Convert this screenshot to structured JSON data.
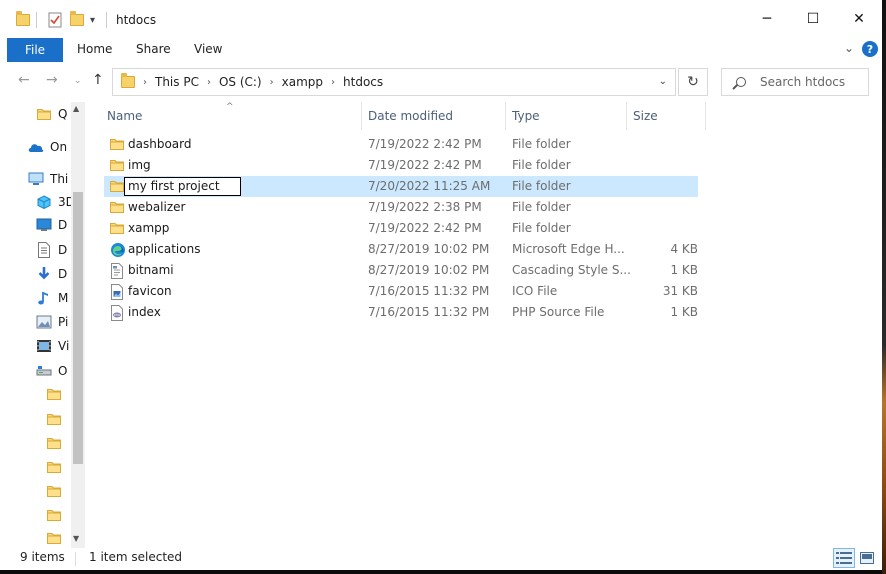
{
  "window": {
    "title": "htdocs",
    "controls": {
      "minimize": "─",
      "maximize": "☐",
      "close": "✕"
    }
  },
  "ribbon": {
    "file": "File",
    "tabs": [
      "Home",
      "Share",
      "View"
    ]
  },
  "address": {
    "crumbs": [
      "This PC",
      "OS (C:)",
      "xampp",
      "htdocs"
    ],
    "search_placeholder": "Search htdocs"
  },
  "nav_pane": {
    "items": [
      {
        "label": "Q",
        "icon": "folder-icon"
      },
      {
        "label": "On",
        "icon": "onedrive-icon"
      },
      {
        "label": "Thi",
        "icon": "pc-icon"
      },
      {
        "label": "3D",
        "icon": "3d-objects-icon"
      },
      {
        "label": "D",
        "icon": "desktop-icon"
      },
      {
        "label": "D",
        "icon": "documents-icon"
      },
      {
        "label": "D",
        "icon": "downloads-icon"
      },
      {
        "label": "M",
        "icon": "music-icon"
      },
      {
        "label": "Pi",
        "icon": "pictures-icon"
      },
      {
        "label": "Vi",
        "icon": "videos-icon"
      },
      {
        "label": "O",
        "icon": "drive-icon"
      },
      {
        "label": "",
        "icon": "folder-icon"
      },
      {
        "label": "",
        "icon": "folder-icon"
      },
      {
        "label": "",
        "icon": "folder-icon"
      },
      {
        "label": "",
        "icon": "folder-icon"
      },
      {
        "label": "",
        "icon": "folder-icon"
      },
      {
        "label": "",
        "icon": "folder-icon"
      },
      {
        "label": "",
        "icon": "folder-icon"
      }
    ]
  },
  "columns": {
    "name": "Name",
    "date": "Date modified",
    "type": "Type",
    "size": "Size"
  },
  "files": [
    {
      "name": "dashboard",
      "date": "7/19/2022 2:42 PM",
      "type": "File folder",
      "size": "",
      "icon": "folder-icon"
    },
    {
      "name": "img",
      "date": "7/19/2022 2:42 PM",
      "type": "File folder",
      "size": "",
      "icon": "folder-icon"
    },
    {
      "name": "my first project",
      "date": "7/20/2022 11:25 AM",
      "type": "File folder",
      "size": "",
      "icon": "folder-icon",
      "selected": true,
      "renaming": true
    },
    {
      "name": "webalizer",
      "date": "7/19/2022 2:38 PM",
      "type": "File folder",
      "size": "",
      "icon": "folder-icon"
    },
    {
      "name": "xampp",
      "date": "7/19/2022 2:42 PM",
      "type": "File folder",
      "size": "",
      "icon": "folder-icon"
    },
    {
      "name": "applications",
      "date": "8/27/2019 10:02 PM",
      "type": "Microsoft Edge H...",
      "size": "4 KB",
      "icon": "edge-icon"
    },
    {
      "name": "bitnami",
      "date": "8/27/2019 10:02 PM",
      "type": "Cascading Style S...",
      "size": "1 KB",
      "icon": "css-file-icon"
    },
    {
      "name": "favicon",
      "date": "7/16/2015 11:32 PM",
      "type": "ICO File",
      "size": "31 KB",
      "icon": "ico-file-icon"
    },
    {
      "name": "index",
      "date": "7/16/2015 11:32 PM",
      "type": "PHP Source File",
      "size": "1 KB",
      "icon": "php-file-icon"
    }
  ],
  "status": {
    "count": "9 items",
    "selection": "1 item selected"
  },
  "colors": {
    "accent": "#1a6fc9",
    "selection": "#cce8ff",
    "folder": "#f7d26a"
  }
}
